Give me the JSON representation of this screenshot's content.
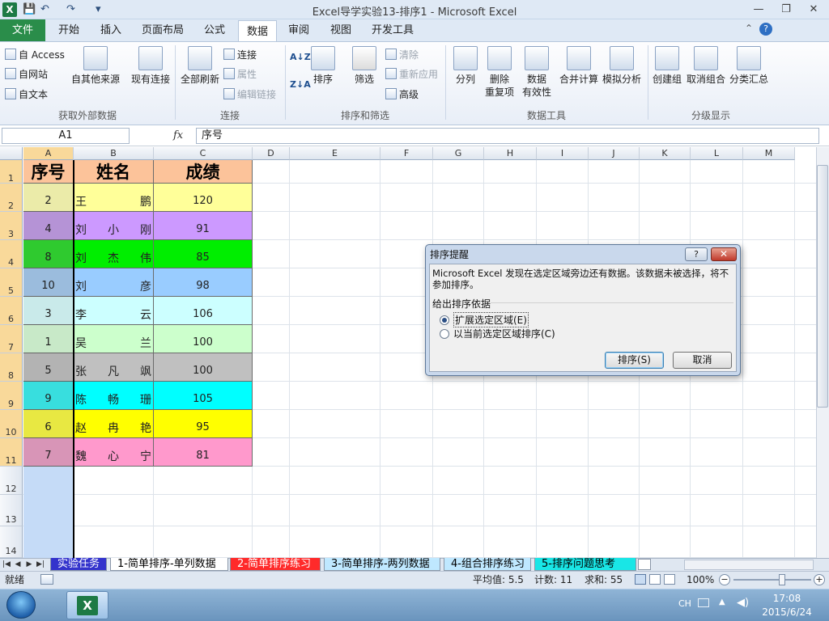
{
  "window": {
    "title": "Excel导学实验13-排序1  -  Microsoft Excel",
    "app_letter": "X",
    "minimize": "—",
    "restore": "❐",
    "close": "✕"
  },
  "qat": {
    "save": "💾",
    "undo": "↶",
    "redo": "↷",
    "customize": "▾"
  },
  "tabs": {
    "file": "文件",
    "home": "开始",
    "insert": "插入",
    "layout": "页面布局",
    "formulas": "公式",
    "data": "数据",
    "review": "审阅",
    "view": "视图",
    "developer": "开发工具"
  },
  "ribbon": {
    "ext": {
      "access": "自 Access",
      "web": "自网站",
      "text": "自文本",
      "other": "自其他来源",
      "existing": "现有连接",
      "label": "获取外部数据"
    },
    "conn": {
      "refresh": "全部刷新",
      "connections": "连接",
      "properties": "属性",
      "edit_links": "编辑链接",
      "label": "连接"
    },
    "sort": {
      "az": "A↓Z",
      "za": "Z↓A",
      "sort": "排序",
      "filter": "筛选",
      "clear": "清除",
      "reapply": "重新应用",
      "advanced": "高级",
      "label": "排序和筛选"
    },
    "tools": {
      "split": "分列",
      "remove_dup_1": "删除",
      "remove_dup_2": "重复项",
      "validation_1": "数据",
      "validation_2": "有效性",
      "consolidate": "合并计算",
      "whatif": "模拟分析",
      "label": "数据工具"
    },
    "outline": {
      "group": "创建组",
      "ungroup": "取消组合",
      "subtotal": "分类汇总",
      "label": "分级显示"
    }
  },
  "formula_bar": {
    "name_box": "A1",
    "fx": "fx",
    "content": "序号"
  },
  "columns": [
    "A",
    "B",
    "C",
    "D",
    "E",
    "F",
    "G",
    "H",
    "I",
    "J",
    "K",
    "L",
    "M"
  ],
  "rows": [
    "1",
    "2",
    "3",
    "4",
    "5",
    "6",
    "7",
    "8",
    "9",
    "10",
    "11",
    "12",
    "13",
    "14"
  ],
  "table": {
    "headers": [
      "序号",
      "姓名",
      "成绩"
    ],
    "data": [
      {
        "id": "2",
        "name": [
          "王",
          "",
          "鹏"
        ],
        "score": "120",
        "color": "#ffff99"
      },
      {
        "id": "4",
        "name": [
          "刘",
          "小",
          "刚"
        ],
        "score": "91",
        "color": "#cc99ff"
      },
      {
        "id": "8",
        "name": [
          "刘",
          "杰",
          "伟"
        ],
        "score": "85",
        "color": "#00ee00"
      },
      {
        "id": "10",
        "name": [
          "刘",
          "",
          "彦"
        ],
        "score": "98",
        "color": "#99ccff"
      },
      {
        "id": "3",
        "name": [
          "李",
          "",
          "云"
        ],
        "score": "106",
        "color": "#ccffff"
      },
      {
        "id": "1",
        "name": [
          "吴",
          "",
          "兰"
        ],
        "score": "100",
        "color": "#ccffcc"
      },
      {
        "id": "5",
        "name": [
          "张",
          "凡",
          "飒"
        ],
        "score": "100",
        "color": "#c0c0c0"
      },
      {
        "id": "9",
        "name": [
          "陈",
          "畅",
          "珊"
        ],
        "score": "105",
        "color": "#00ffff"
      },
      {
        "id": "6",
        "name": [
          "赵",
          "冉",
          "艳"
        ],
        "score": "95",
        "color": "#ffff00"
      },
      {
        "id": "7",
        "name": [
          "魏",
          "心",
          "宁"
        ],
        "score": "81",
        "color": "#ff99cc"
      }
    ]
  },
  "sheet_tabs": [
    {
      "label": "实验任务",
      "bg": "#3333cc",
      "fg": "#ffffff"
    },
    {
      "label": "1-简单排序-单列数据",
      "bg": "#ffffff",
      "fg": "#000000"
    },
    {
      "label": "2-简单排序练习",
      "bg": "#ff2a2a",
      "fg": "#ffffff"
    },
    {
      "label": "3-简单排序-两列数据",
      "bg": "#bfe8ff",
      "fg": "#000000"
    },
    {
      "label": "4-组合排序练习",
      "bg": "#bfe8ff",
      "fg": "#000000"
    },
    {
      "label": "5-排序问题思考",
      "bg": "#19e6e6",
      "fg": "#000000"
    }
  ],
  "status": {
    "ready": "就绪",
    "average": "平均值: 5.5",
    "count": "计数: 11",
    "sum": "求和: 55",
    "zoom": "100%"
  },
  "taskbar": {
    "lang": "CH",
    "time": "17:08",
    "date": "2015/6/24"
  },
  "dialog": {
    "title": "排序提醒",
    "help": "?",
    "close": "✕",
    "message": "Microsoft Excel 发现在选定区域旁边还有数据。该数据未被选择，将不参加排序。",
    "group_label": "给出排序依据",
    "option_expand": "扩展选定区域(E)",
    "option_current": "以当前选定区域排序(C)",
    "sort_button": "排序(S)",
    "cancel_button": "取消"
  }
}
